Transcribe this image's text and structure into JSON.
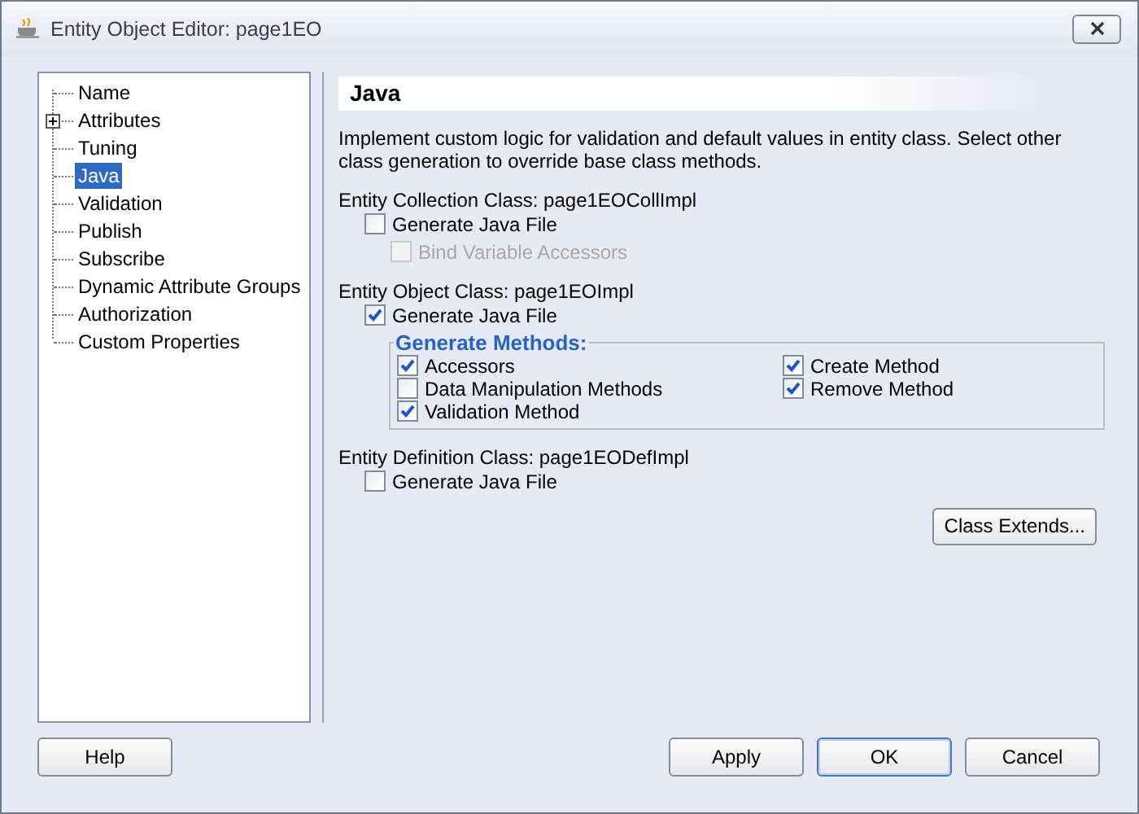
{
  "window": {
    "title": "Entity Object Editor: page1EO"
  },
  "nav": [
    {
      "label": "Name",
      "kind": "leaf",
      "selected": false
    },
    {
      "label": "Attributes",
      "kind": "group",
      "expanded": false,
      "selected": false
    },
    {
      "label": "Tuning",
      "kind": "leaf",
      "selected": false
    },
    {
      "label": "Java",
      "kind": "leaf",
      "selected": true
    },
    {
      "label": "Validation",
      "kind": "leaf",
      "selected": false
    },
    {
      "label": "Publish",
      "kind": "leaf",
      "selected": false
    },
    {
      "label": "Subscribe",
      "kind": "leaf",
      "selected": false
    },
    {
      "label": "Dynamic Attribute Groups",
      "kind": "leaf",
      "selected": false
    },
    {
      "label": "Authorization",
      "kind": "leaf",
      "selected": false
    },
    {
      "label": "Custom Properties",
      "kind": "leaf",
      "selected": false
    }
  ],
  "page": {
    "heading": "Java",
    "description": "Implement custom logic for validation and default values in entity class.  Select other class generation to override base class methods.",
    "sections": [
      {
        "label": "Entity Collection Class: page1EOCollImpl",
        "option": {
          "label": "Generate Java File",
          "checked": false,
          "disabled": false
        },
        "sub_options": [
          {
            "label": "Bind Variable Accessors",
            "checked": false,
            "disabled": true
          }
        ]
      },
      {
        "label": "Entity Object Class: page1EOImpl",
        "option": {
          "label": "Generate Java File",
          "checked": true,
          "disabled": false
        },
        "group": {
          "title": "Generate Methods:",
          "columns": [
            [
              {
                "label": "Accessors",
                "checked": true
              },
              {
                "label": "Data Manipulation Methods",
                "checked": false
              },
              {
                "label": "Validation Method",
                "checked": true
              }
            ],
            [
              {
                "label": "Create Method",
                "checked": true
              },
              {
                "label": "Remove Method",
                "checked": true
              }
            ]
          ]
        }
      },
      {
        "label": "Entity Definition Class: page1EODefImpl",
        "option": {
          "label": "Generate Java File",
          "checked": false,
          "disabled": false
        }
      }
    ],
    "class_extends_button": "Class Extends..."
  },
  "buttons": [
    {
      "label": "Help",
      "default": false
    },
    {
      "label": "Apply",
      "default": false
    },
    {
      "label": "OK",
      "default": true
    },
    {
      "label": "Cancel",
      "default": false
    }
  ]
}
